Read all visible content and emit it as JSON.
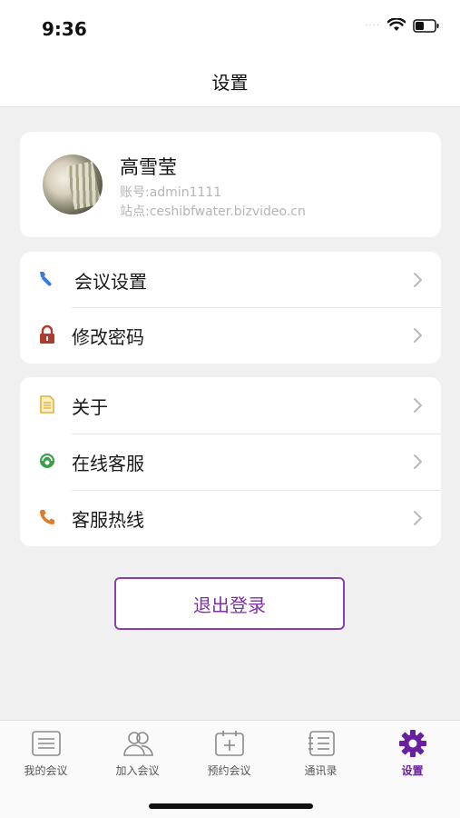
{
  "status_bar": {
    "time": "9:36",
    "signal": "····"
  },
  "header": {
    "title": "设置"
  },
  "profile": {
    "name": "高雪莹",
    "account": "账号:admin1111",
    "site": "站点:ceshibfwater.bizvideo.cn"
  },
  "menu_group_1": [
    {
      "label": "会议设置",
      "icon": "wrench-icon"
    },
    {
      "label": "修改密码",
      "icon": "lock-icon"
    }
  ],
  "menu_group_2": [
    {
      "label": "关于",
      "icon": "document-icon"
    },
    {
      "label": "在线客服",
      "icon": "chat-service-icon"
    },
    {
      "label": "客服热线",
      "icon": "phone-icon"
    }
  ],
  "logout": {
    "label": "退出登录"
  },
  "tabs": [
    {
      "label": "我的会议",
      "icon": "list-icon",
      "active": false
    },
    {
      "label": "加入会议",
      "icon": "people-icon",
      "active": false
    },
    {
      "label": "预约会议",
      "icon": "calendar-plus-icon",
      "active": false
    },
    {
      "label": "通讯录",
      "icon": "contacts-book-icon",
      "active": false
    },
    {
      "label": "设置",
      "icon": "gear-icon",
      "active": true
    }
  ],
  "colors": {
    "accent": "#7e2fa8",
    "background": "#f0f0f0",
    "wrench": "#3b7bd8",
    "lock": "#b03a2e",
    "document": "#e0b23a",
    "chat": "#3aa14a",
    "phone": "#e07b2a"
  }
}
